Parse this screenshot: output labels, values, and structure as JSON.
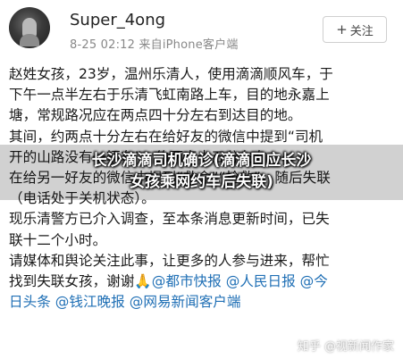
{
  "header": {
    "username": "Super_4ong",
    "meta": "8-25 02:12  来自iPhone客户端",
    "follow_icon": "plus-icon",
    "follow_plus": "+",
    "follow_label": "关注"
  },
  "post": {
    "lines": [
      "赵姓女孩，23岁，温州乐清人，使用滴滴顺风车，于",
      "下午一点半左右于乐清飞虹南路上车，目的地永嘉上",
      "塘，常规路况应在两点四十分左右到达目的地。",
      "其间，约两点十分左右在给好友的微信中提到“司机",
      "开的山路没有一辆车”，约两点十五分左右",
      "在给另一好友的微信中提到“救命”“抢救”，随后失联",
      "（电话处于关机状态）。",
      "现乐清警方已介入调查，至本条消息更新时间，已失",
      "联十二个小时。",
      "请媒体和舆论关注此事，让更多的人参与进来，帮忙",
      "找到失联女孩，谢谢🙏"
    ],
    "mentions_line1": [
      "@都市快报",
      "@人民日报",
      "@今"
    ],
    "mentions_line2_prefix": "日头条",
    "mentions_line2": [
      "@钱江晚报",
      "@网易新闻客户端"
    ]
  },
  "overlay": {
    "line1": "长沙滴滴司机确诊(滴滴回应长沙",
    "line2": "女孩乘网约车后失联)"
  },
  "watermark": "知乎 @视新闻作家"
}
